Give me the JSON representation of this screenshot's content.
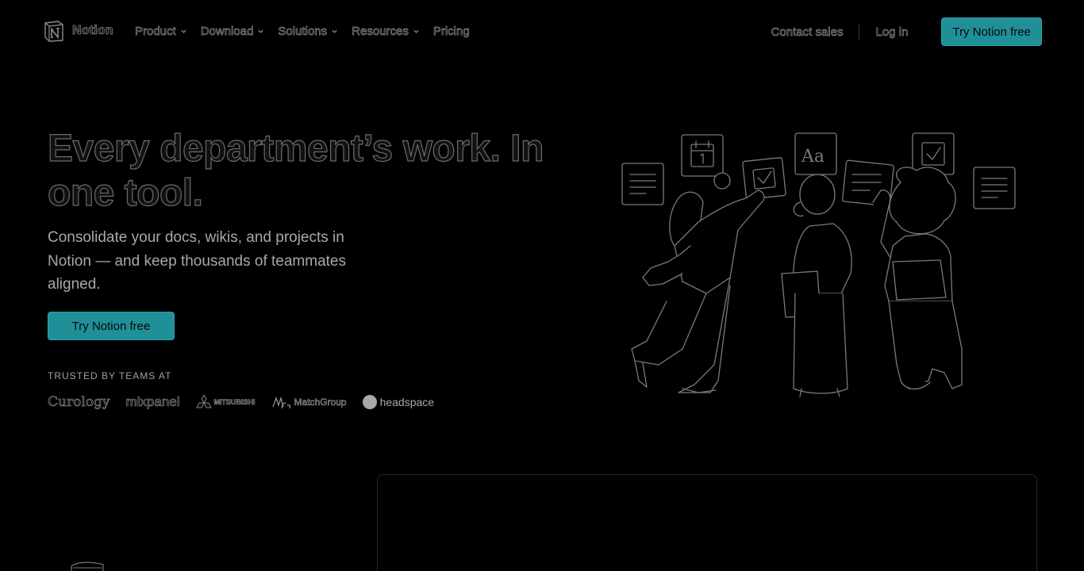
{
  "nav": {
    "brand": "Notion",
    "items": [
      {
        "label": "Product",
        "has_dropdown": true
      },
      {
        "label": "Download",
        "has_dropdown": true
      },
      {
        "label": "Solutions",
        "has_dropdown": true
      },
      {
        "label": "Resources",
        "has_dropdown": true
      },
      {
        "label": "Pricing",
        "has_dropdown": false
      }
    ],
    "contact_sales": "Contact sales",
    "login": "Log in",
    "cta": "Try Notion free"
  },
  "hero": {
    "title": "Every department’s work. In one tool.",
    "subtitle": "Consolidate your docs, wikis, and projects in Notion — and keep thousands of teammates aligned.",
    "cta": "Try Notion free",
    "trusted_label": "TRUSTED BY TEAMS AT",
    "logos": [
      "Curology",
      "mixpanel",
      "MITSUBISHI",
      "MatchGroup",
      "headspace"
    ]
  },
  "colors": {
    "accent": "#1f8f98",
    "background": "#000000"
  }
}
